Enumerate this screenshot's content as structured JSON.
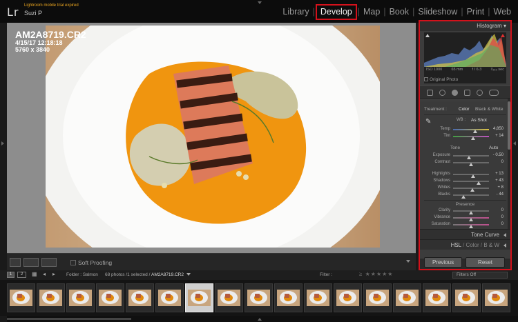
{
  "app": {
    "logo": "Lr",
    "trial_text": "Lightroom mobile trial expired",
    "user": "Suzi P"
  },
  "modules": [
    {
      "label": "Library",
      "active": false
    },
    {
      "label": "Develop",
      "active": true
    },
    {
      "label": "Map",
      "active": false
    },
    {
      "label": "Book",
      "active": false
    },
    {
      "label": "Slideshow",
      "active": false
    },
    {
      "label": "Print",
      "active": false
    },
    {
      "label": "Web",
      "active": false
    }
  ],
  "photo_info": {
    "filename": "AM2A8719.CR2",
    "datetime": "4/15/17 12:18:18",
    "dimensions": "5760 x 3840"
  },
  "toolbar": {
    "soft_proofing": "Soft Proofing"
  },
  "histogram": {
    "title": "Histogram",
    "iso": "ISO 1000",
    "focal": "65 mm",
    "aperture": "f / 6.3",
    "shutter": "¹⁄₂₅₀ sec",
    "original_photo": "Original Photo"
  },
  "basic": {
    "treatment_label": "Treatment :",
    "color": "Color",
    "bw": "Black & White",
    "wb_label": "WB :",
    "wb_value": "As Shot",
    "temp": {
      "label": "Temp",
      "value": "4,850",
      "level": 0.62
    },
    "tint": {
      "label": "Tint",
      "value": "+ 14",
      "level": 0.56
    },
    "tone_label": "Tone",
    "auto": "Auto",
    "exposure": {
      "label": "Exposure",
      "value": "- 0.50",
      "level": 0.45
    },
    "contrast": {
      "label": "Contrast",
      "value": "0",
      "level": 0.5
    },
    "highlights": {
      "label": "Highlights",
      "value": "+ 13",
      "level": 0.56
    },
    "shadows": {
      "label": "Shadows",
      "value": "+ 43",
      "level": 0.71
    },
    "whites": {
      "label": "Whites",
      "value": "+ 8",
      "level": 0.54
    },
    "blacks": {
      "label": "Blacks",
      "value": "- 44",
      "level": 0.28
    },
    "presence_label": "Presence",
    "clarity": {
      "label": "Clarity",
      "value": "0",
      "level": 0.5
    },
    "vibrance": {
      "label": "Vibrance",
      "value": "0",
      "level": 0.5
    },
    "saturation": {
      "label": "Saturation",
      "value": "0",
      "level": 0.5
    }
  },
  "panels": {
    "tone_curve": "Tone Curve",
    "hsl": "HSL",
    "color": "Color",
    "bw": "B & W"
  },
  "buttons": {
    "previous": "Previous",
    "reset": "Reset"
  },
  "filmbar": {
    "view1": "1",
    "view2": "2",
    "folder": "Folder : Salmon",
    "count": "68 photos /1 selected /",
    "selected_file": "AM2A8719.CR2",
    "filter_label": "Filter :",
    "filters_off": "Filters Off"
  },
  "colors": {
    "highlight_red": "#d4111b",
    "panel_bg": "#3c3c3c",
    "accent_yellow": "#e8a420"
  }
}
